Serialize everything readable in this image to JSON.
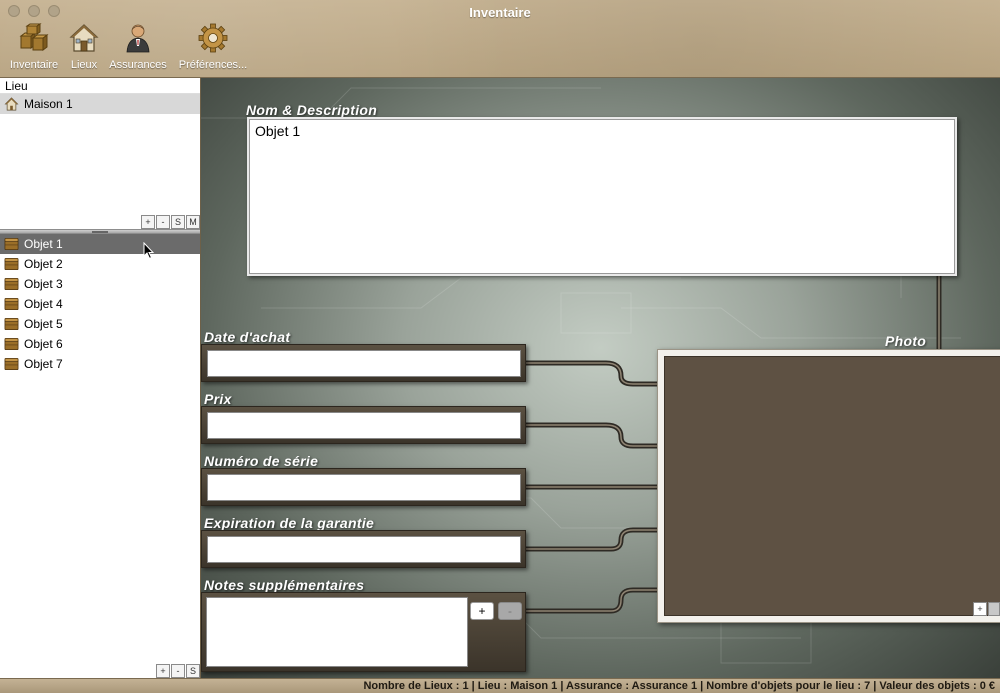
{
  "window": {
    "title": "Inventaire"
  },
  "toolbar": {
    "items": [
      {
        "label": "Inventaire",
        "icon": "boxes-icon"
      },
      {
        "label": "Lieux",
        "icon": "house-icon"
      },
      {
        "label": "Assurances",
        "icon": "agent-icon"
      },
      {
        "label": "Préférences...",
        "icon": "gear-icon"
      }
    ]
  },
  "sidebar": {
    "lieu_header": "Lieu",
    "lieux": [
      {
        "label": "Maison 1"
      }
    ],
    "lieux_buttons": [
      "+",
      "-",
      "S",
      "M"
    ],
    "objets": [
      {
        "label": "Objet 1"
      },
      {
        "label": "Objet 2"
      },
      {
        "label": "Objet 3"
      },
      {
        "label": "Objet 4"
      },
      {
        "label": "Objet 5"
      },
      {
        "label": "Objet 6"
      },
      {
        "label": "Objet 7"
      }
    ],
    "objets_buttons": [
      "+",
      "-",
      "S"
    ]
  },
  "form": {
    "name_label": "Nom & Description",
    "name_value": "Objet 1",
    "date_label": "Date d'achat",
    "date_value": "",
    "price_label": "Prix",
    "price_value": "",
    "serial_label": "Numéro de série",
    "serial_value": "",
    "warranty_label": "Expiration de la garantie",
    "warranty_value": "",
    "notes_label": "Notes supplémentaires",
    "notes_value": "",
    "notes_add": "+",
    "notes_remove": "-",
    "photo_label": "Photo",
    "photo_add": "+"
  },
  "status": {
    "text": "Nombre de Lieux : 1 | Lieu : Maison 1 | Assurance : Assurance 1 | Nombre d'objets pour le lieu : 7 | Valeur des objets : 0 €"
  },
  "colors": {
    "toolbar": "#bba885",
    "selection_dark": "#6b6b6b",
    "photo_bg": "#5e5143"
  }
}
